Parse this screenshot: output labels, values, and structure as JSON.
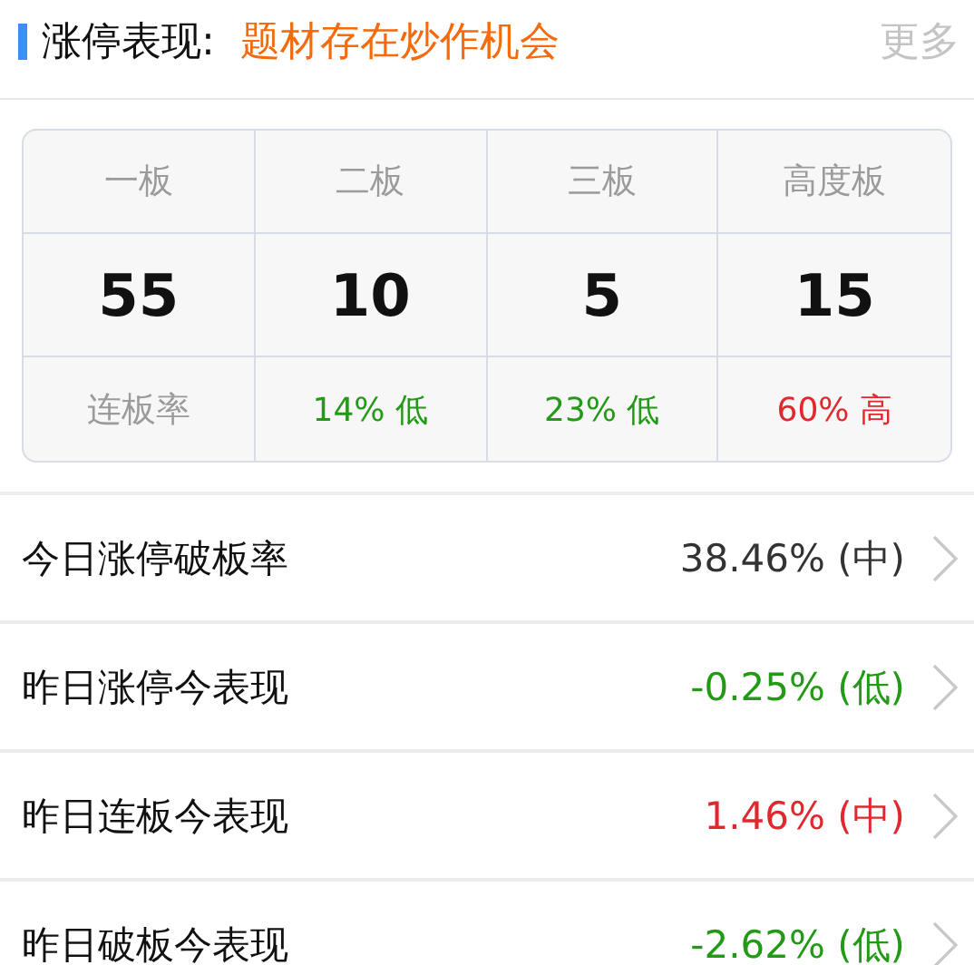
{
  "header": {
    "title": "涨停表现:",
    "subtitle": "题材存在炒作机会",
    "more": "更多"
  },
  "board_table": {
    "columns": [
      {
        "label": "一板",
        "count": "55"
      },
      {
        "label": "二板",
        "count": "10",
        "rate": "14% 低",
        "color": "#229a16"
      },
      {
        "label": "三板",
        "count": "5",
        "rate": "23% 低",
        "color": "#229a16"
      },
      {
        "label": "高度板",
        "count": "15",
        "rate": "60% 高",
        "color": "#e0282e"
      }
    ],
    "rate_label": "连板率"
  },
  "rows": [
    {
      "label": "今日涨停破板率",
      "value": "38.46% (中)",
      "color": "#333333"
    },
    {
      "label": "昨日涨停今表现",
      "value": "-0.25% (低)",
      "color": "#229a16"
    },
    {
      "label": "昨日连板今表现",
      "value": "1.46% (中)",
      "color": "#e0282e"
    },
    {
      "label": "昨日破板今表现",
      "value": "-2.62% (低)",
      "color": "#229a16"
    }
  ]
}
